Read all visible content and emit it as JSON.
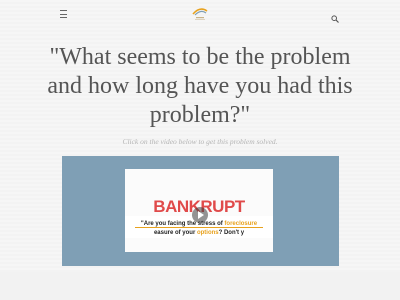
{
  "header": {
    "menu_icon": "hamburger-icon",
    "logo_icon": "house-swoosh-logo",
    "search_icon": "search-icon"
  },
  "main": {
    "headline": "\"What seems to be the problem and how long have you had this problem?\"",
    "subtitle": "Click on the video below to get this problem solved.",
    "video": {
      "thumb_title": "BANKRUPT",
      "line1_prefix": "\"Are you facing the stress of ",
      "line1_highlight": "foreclosure",
      "line2_prefix": "easure of your ",
      "line2_highlight": "options",
      "line2_suffix": "? Don't y",
      "play_icon": "play-icon"
    }
  },
  "colors": {
    "video_panel": "#7f9fb5",
    "headline": "#555555",
    "subtitle": "#b5b5b5",
    "accent_red": "#e04a4a",
    "accent_orange": "#e8a21e"
  }
}
